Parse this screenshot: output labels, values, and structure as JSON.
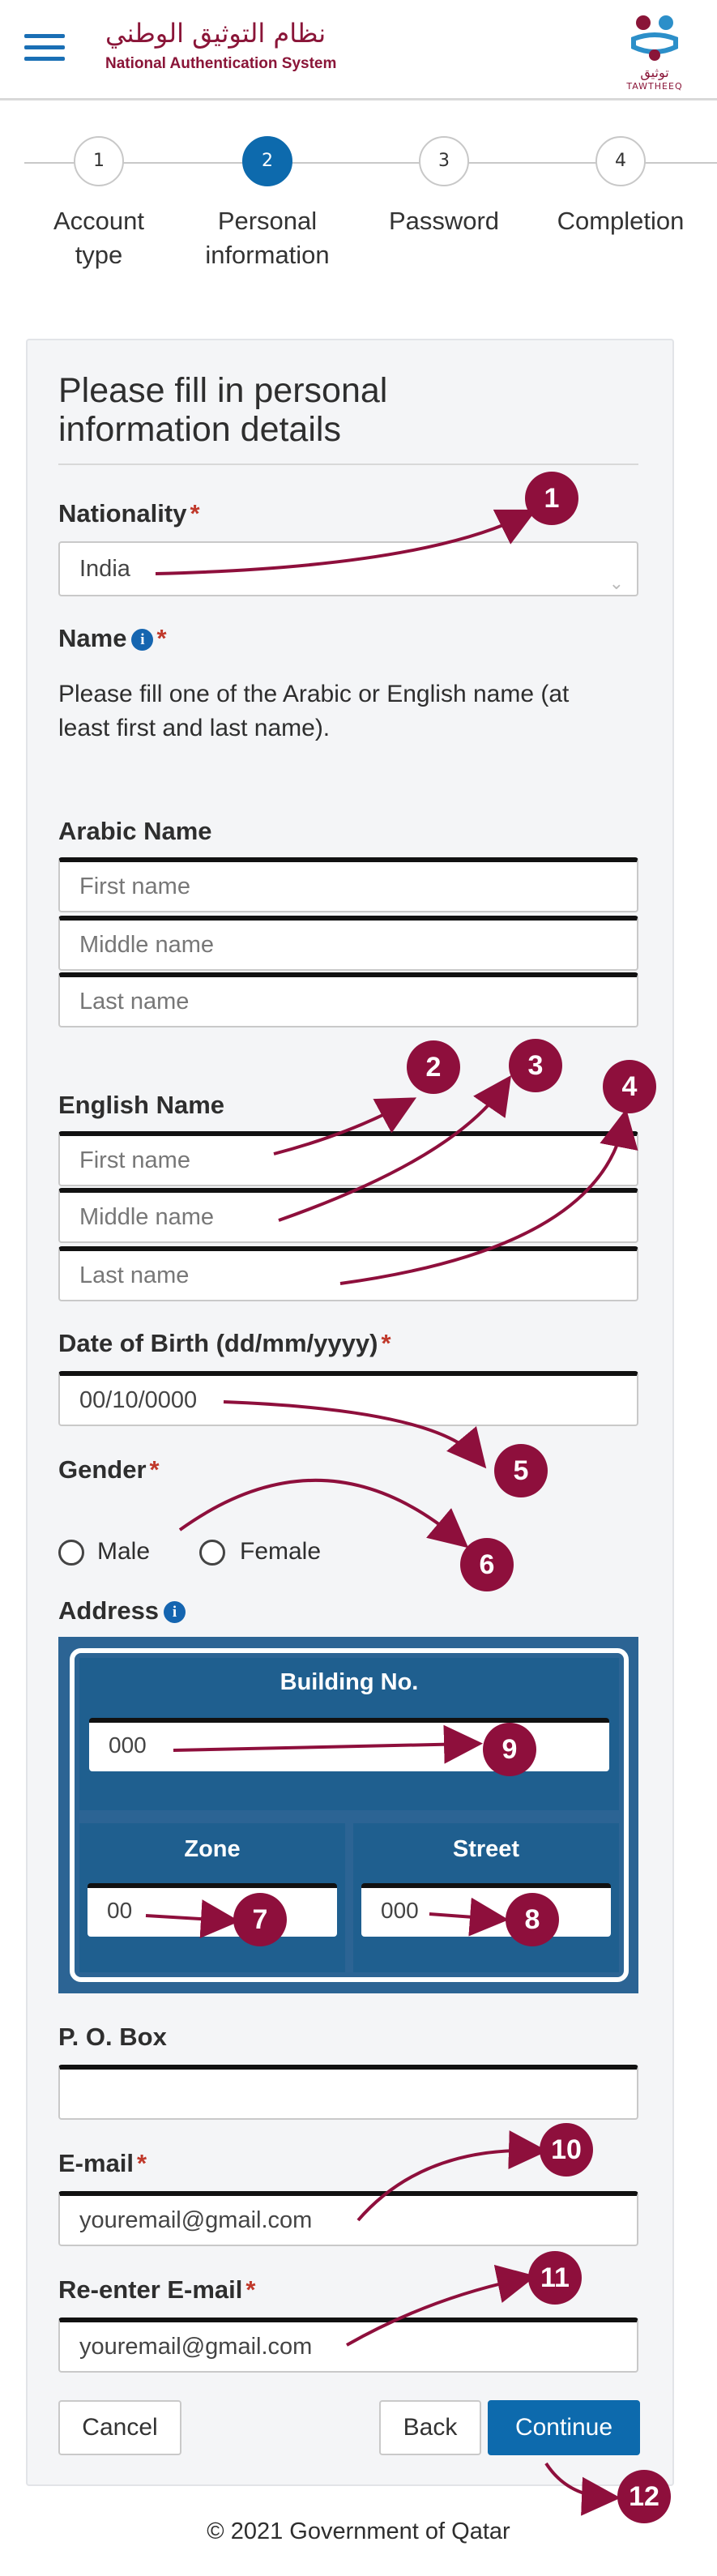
{
  "header": {
    "brand_ar": "نظام التوثيق الوطني",
    "brand_en": "National Authentication System",
    "logo_ar": "توثيق",
    "logo_en": "TAWTHEEQ",
    "menu_icon": "hamburger-menu-icon"
  },
  "stepper": [
    {
      "number": "1",
      "label_line1": "Account",
      "label_line2": "type",
      "active": false
    },
    {
      "number": "2",
      "label_line1": "Personal",
      "label_line2": "information",
      "active": true
    },
    {
      "number": "3",
      "label_line1": "Password",
      "label_line2": "",
      "active": false
    },
    {
      "number": "4",
      "label_line1": "Completion",
      "label_line2": "",
      "active": false
    }
  ],
  "form": {
    "title_line1": "Please fill in personal",
    "title_line2": "information details",
    "nationality": {
      "label": "Nationality",
      "required": "*",
      "value": "India"
    },
    "name": {
      "label": "Name",
      "required": "*",
      "note_line1": "Please fill one of the Arabic or English name (at",
      "note_line2": "least first and last name)."
    },
    "arabic_name": {
      "label": "Arabic Name",
      "first_placeholder": "First name",
      "middle_placeholder": "Middle name",
      "last_placeholder": "Last name"
    },
    "english_name": {
      "label": "English Name",
      "first_placeholder": "First name",
      "middle_placeholder": "Middle name",
      "last_placeholder": "Last name"
    },
    "dob": {
      "label": "Date of Birth (dd/mm/yyyy)",
      "required": "*",
      "value": "00/10/0000"
    },
    "gender": {
      "label": "Gender",
      "required": "*",
      "options": [
        "Male",
        "Female"
      ]
    },
    "address": {
      "label": "Address",
      "building_label": "Building No.",
      "building_value": "000",
      "zone_label": "Zone",
      "zone_value": "00",
      "street_label": "Street",
      "street_value": "000"
    },
    "po_box": {
      "label": "P. O. Box",
      "value": ""
    },
    "email": {
      "label": "E-mail",
      "required": "*",
      "value": "youremail@gmail.com"
    },
    "reemail": {
      "label": "Re-enter E-mail",
      "required": "*",
      "value": "youremail@gmail.com"
    },
    "buttons": {
      "cancel": "Cancel",
      "back": "Back",
      "continue": "Continue"
    }
  },
  "annotations": [
    "1",
    "2",
    "3",
    "4",
    "5",
    "6",
    "7",
    "8",
    "9",
    "10",
    "11",
    "12"
  ],
  "colors": {
    "primary": "#0d6aad",
    "brand": "#8a1538",
    "badge": "#8e0f3c",
    "address_bg": "#2c6494"
  },
  "footer": {
    "text": "© 2021 Government of Qatar"
  }
}
